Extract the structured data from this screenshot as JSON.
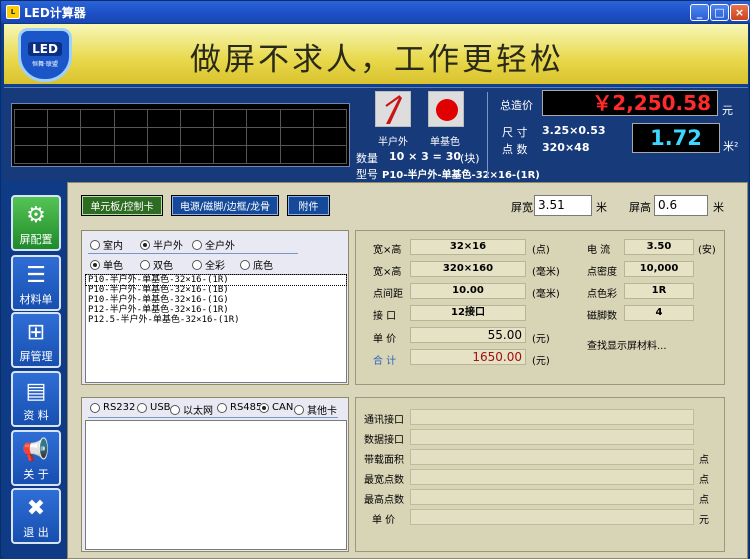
{
  "window": {
    "title": "LED计算器"
  },
  "logo": {
    "text": "LED",
    "sub": "恒舞·联盟"
  },
  "banner": {
    "slogan": "做屏不求人，工作更轻松"
  },
  "info": {
    "type1_label": "半户外",
    "type2_label": "单基色",
    "qty_label": "数量",
    "qty_value": "10 × 3 = 30",
    "qty_unit": "(块)",
    "model_label": "型号",
    "model_value": "P10-半户外-单基色-32×16-(1R)",
    "total_label": "总造价",
    "total_value": "￥2,250.58",
    "total_unit": "元",
    "size_label": "尺  寸",
    "size_value": "3.25×0.53",
    "dots_label": "点  数",
    "dots_value": "320×48",
    "area_value": "1.72",
    "area_unit": "米²"
  },
  "sidebar": [
    {
      "label": "屏配置"
    },
    {
      "label": "材料单"
    },
    {
      "label": "屏管理"
    },
    {
      "label": "资  料"
    },
    {
      "label": "关  于"
    },
    {
      "label": "退  出"
    }
  ],
  "tabs": {
    "t1": "单元板/控制卡",
    "t2": "电源/磁脚/边框/龙骨",
    "t3": "附件"
  },
  "screen": {
    "width_label": "屏宽",
    "width_value": "3.51",
    "width_unit": "米",
    "height_label": "屏高",
    "height_value": "0.6",
    "height_unit": "米"
  },
  "env": {
    "indoor": "室内",
    "semi": "半户外",
    "outdoor": "全户外"
  },
  "color": {
    "mono": "单色",
    "dual": "双色",
    "full": "全彩",
    "bottom": "底色"
  },
  "models": [
    "P10-半户外-单基色-32×16-(1R)",
    "P10-半户外-单基色-32×16-(1B)",
    "P10-半户外-单基色-32×16-(1G)",
    "P12-半户外-单基色-32×16-(1R)",
    "P12.5-半户外-单基色-32×16-(1R)"
  ],
  "params": {
    "wh_label": "宽×高",
    "wh_value": "32×16",
    "wh_unit": "(点)",
    "wh2_label": "宽×高",
    "wh2_value": "320×160",
    "wh2_unit": "(毫米)",
    "pitch_label": "点间距",
    "pitch_value": "10.00",
    "pitch_unit": "(毫米)",
    "port_label": "接  口",
    "port_value": "12接口",
    "price_label": "单  价",
    "price_value": "55.00",
    "price_unit": "(元)",
    "total_label": "合  计",
    "total_value": "1650.00",
    "total_unit": "(元)",
    "current_label": "电  流",
    "current_value": "3.50",
    "current_unit": "(安)",
    "density_label": "点密度",
    "density_value": "10,000",
    "dotcolor_label": "点色彩",
    "dotcolor_value": "1R",
    "magnet_label": "磁脚数",
    "magnet_value": "4",
    "link": "查找显示屏材料..."
  },
  "ctrl": {
    "rs232": "RS232",
    "usb": "USB",
    "eth": "以太网",
    "rs485": "RS485",
    "can": "CAN",
    "other": "其他卡"
  },
  "ctrlparams": {
    "comm": "通讯接口",
    "data": "数据接口",
    "area": "带载面积",
    "area_unit": "点",
    "maxw": "最宽点数",
    "maxw_unit": "点",
    "maxh": "最高点数",
    "maxh_unit": "点",
    "price": "单  价",
    "price_unit": "元"
  },
  "colors": {
    "price_red": "#ff2b2b",
    "area_cyan": "#3cd8ff",
    "active_tab": "#2e6c24"
  }
}
